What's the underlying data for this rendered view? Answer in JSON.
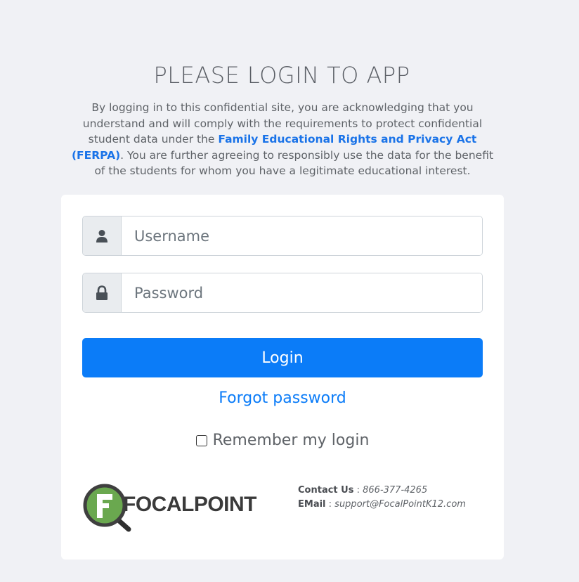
{
  "page": {
    "title": "PLEASE LOGIN TO APP",
    "notice_before": "By logging in to this confidential site, you are acknowledging that you understand and will comply with the requirements to protect confidential student data under the ",
    "notice_link": "Family Educational Rights and Privacy Act (FERPA)",
    "notice_after": ". You are further agreeing to responsibly use the data for the benefit of the students for whom you have a legitimate educational interest."
  },
  "form": {
    "username_placeholder": "Username",
    "username_value": "",
    "password_placeholder": "Password",
    "password_value": "",
    "login_label": "Login",
    "forgot_label": "Forgot password",
    "remember_label": "Remember my login",
    "remember_checked": false
  },
  "footer": {
    "logo_text": "FOCALPOINT",
    "contact_label": "Contact Us",
    "contact_value": "866-377-4265",
    "email_label": "EMail",
    "email_value": "support@FocalPointK12.com",
    "separator": " : "
  },
  "colors": {
    "background": "#f0f1f5",
    "primary": "#0b7cf8",
    "logo_green": "#6aa84f"
  },
  "icons": {
    "username": "user-icon",
    "password": "lock-icon"
  }
}
